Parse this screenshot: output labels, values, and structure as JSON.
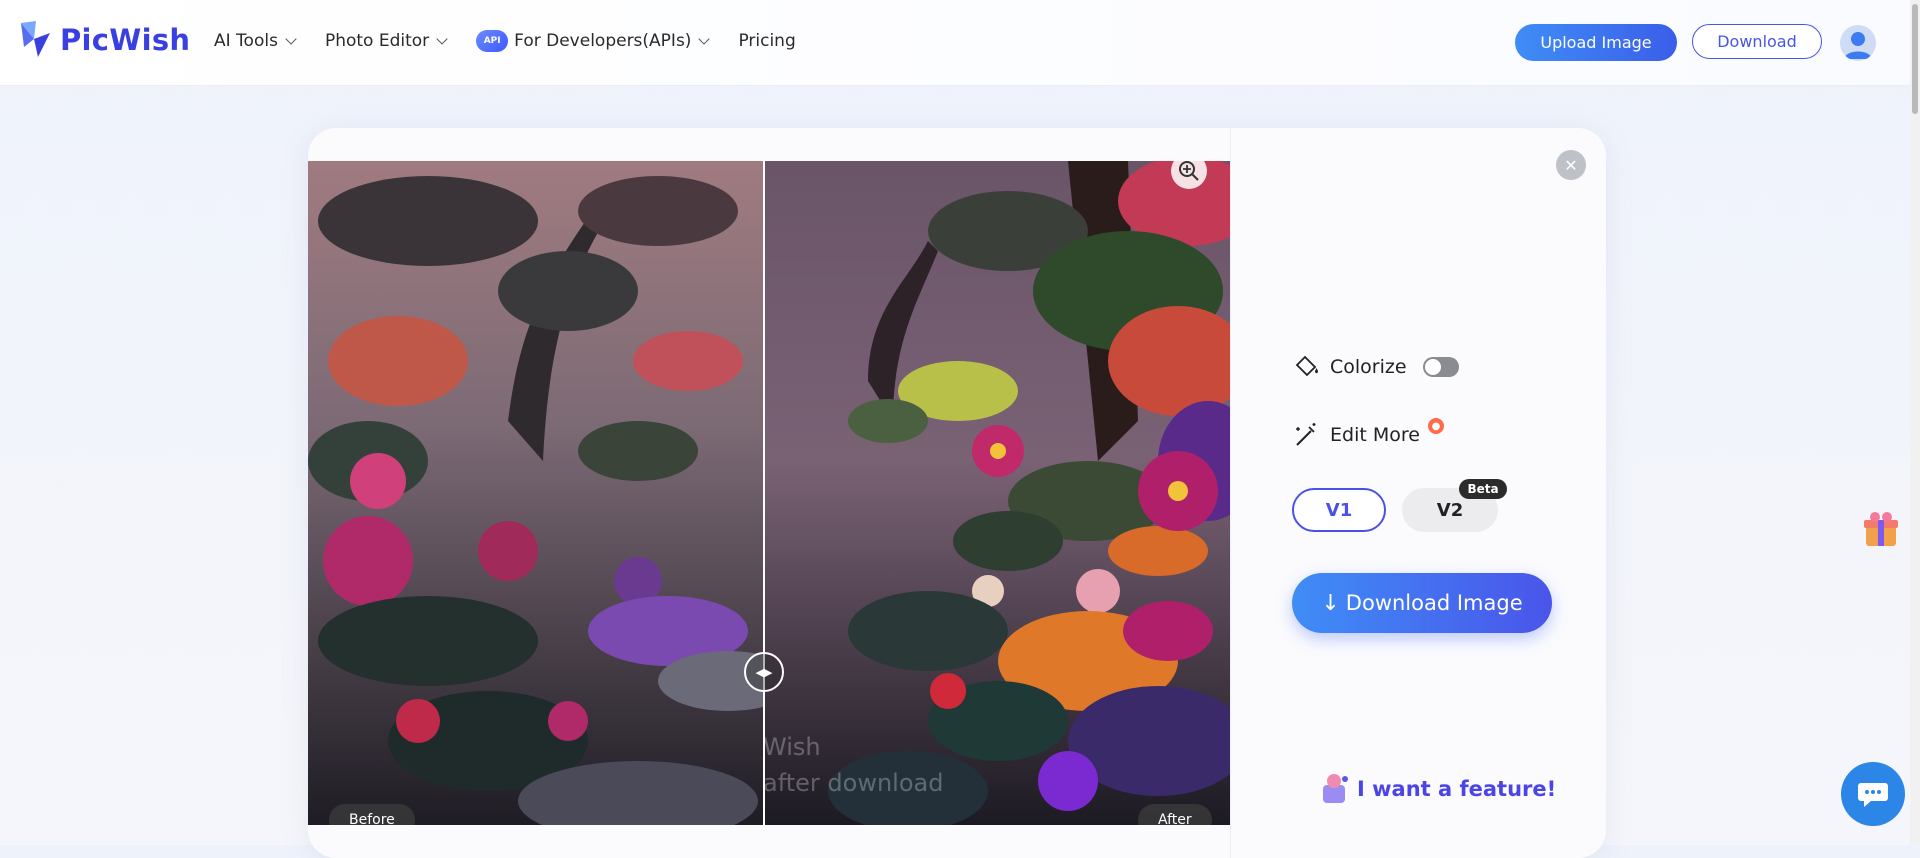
{
  "header": {
    "logo_text": "PicWish",
    "nav": [
      {
        "label": "AI Tools",
        "has_dropdown": true
      },
      {
        "label": "Photo Editor",
        "has_dropdown": true
      },
      {
        "label": "For Developers(APIs)",
        "has_dropdown": true,
        "badge": "API"
      },
      {
        "label": "Pricing",
        "has_dropdown": false
      }
    ],
    "upload_label": "Upload Image",
    "download_label": "Download",
    "accent": "#3a40e0"
  },
  "viewer": {
    "before_label": "Before",
    "after_label": "After",
    "watermark_line1": "Wish",
    "watermark_line2": "after download"
  },
  "panel": {
    "colorize_label": "Colorize",
    "colorize_on": false,
    "edit_more_label": "Edit More",
    "v1_label": "V1",
    "v2_label": "V2",
    "v2_badge": "Beta",
    "selected_version": "V1",
    "download_image_label": "Download Image",
    "feature_label": "I want a feature!"
  },
  "icons": {
    "zoom": "zoom-in-icon",
    "close": "close-icon",
    "colorize": "paint-bucket-icon",
    "edit": "magic-wand-icon",
    "download": "arrow-down-icon",
    "chat": "chat-bubble-icon",
    "gift": "gift-icon"
  }
}
